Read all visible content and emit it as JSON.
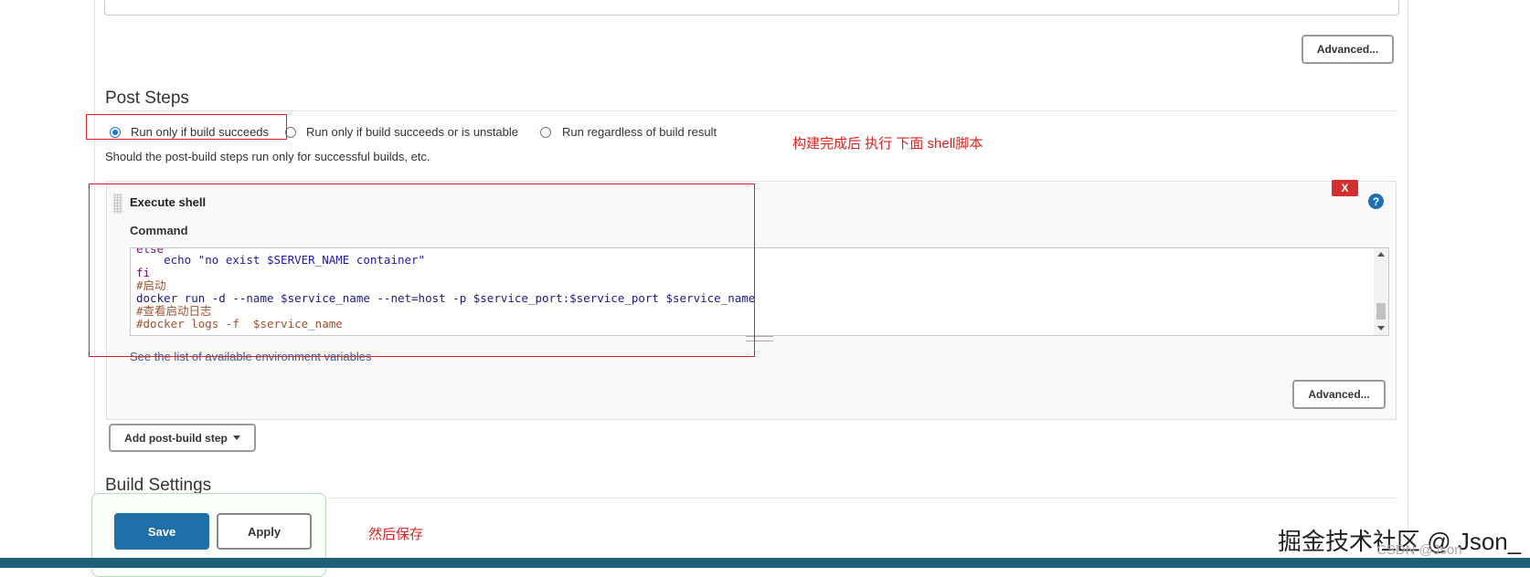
{
  "top_advanced_label": "Advanced...",
  "post_steps": {
    "title": "Post Steps",
    "options": [
      {
        "label": "Run only if build succeeds",
        "checked": true
      },
      {
        "label": "Run only if build succeeds or is unstable",
        "checked": false
      },
      {
        "label": "Run regardless of build result",
        "checked": false
      }
    ],
    "help_text": "Should the post-build steps run only for successful builds, etc."
  },
  "execute_shell": {
    "title": "Execute shell",
    "delete_label": "X",
    "help_label": "?",
    "command_label": "Command",
    "code_lines": [
      "else",
      "    echo \"no exist $SERVER_NAME container\"",
      "fi",
      "#启动",
      "docker run -d --name $service_name --net=host -p $service_port:$service_port $service_name",
      "#查看启动日志",
      "#docker logs -f  $service_name"
    ],
    "env_link": "See the list of available environment variables",
    "advanced_label": "Advanced..."
  },
  "add_post_build_step_label": "Add post-build step",
  "build_settings_title": "Build Settings",
  "save_label": "Save",
  "apply_label": "Apply",
  "annotations": {
    "run_shell": "构建完成后 执行 下面 shell脚本",
    "then_save": "然后保存"
  },
  "watermark": "掘金技术社区 @ Json_",
  "csdn_mark": "CSDN @Json",
  "colors": {
    "save_bg": "#1f6fa8",
    "annotation_red": "#e02020",
    "delete_red": "#d32f2f",
    "bottom_bar": "#1d5f78"
  }
}
